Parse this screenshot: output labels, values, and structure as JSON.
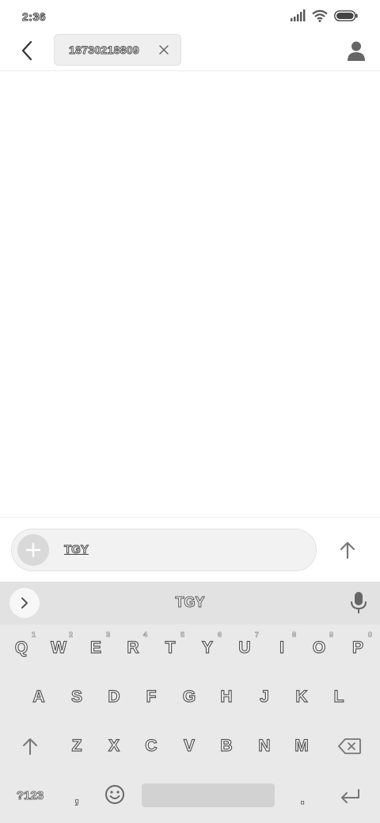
{
  "status_bar": {
    "time": "2:36"
  },
  "header": {
    "recipient": "18730218809"
  },
  "compose": {
    "text": "TGY"
  },
  "keyboard": {
    "suggestion": "TGY",
    "row1": [
      {
        "label": "Q",
        "hint": "1"
      },
      {
        "label": "W",
        "hint": "2"
      },
      {
        "label": "E",
        "hint": "3"
      },
      {
        "label": "R",
        "hint": "4"
      },
      {
        "label": "T",
        "hint": "5"
      },
      {
        "label": "Y",
        "hint": "6"
      },
      {
        "label": "U",
        "hint": "7"
      },
      {
        "label": "I",
        "hint": "8"
      },
      {
        "label": "O",
        "hint": "9"
      },
      {
        "label": "P",
        "hint": "0"
      }
    ],
    "row2": [
      "A",
      "S",
      "D",
      "F",
      "G",
      "H",
      "J",
      "K",
      "L"
    ],
    "row3": [
      "Z",
      "X",
      "C",
      "V",
      "B",
      "N",
      "M"
    ],
    "symbols_label": "?123",
    "comma_label": ",",
    "period_label": "."
  }
}
